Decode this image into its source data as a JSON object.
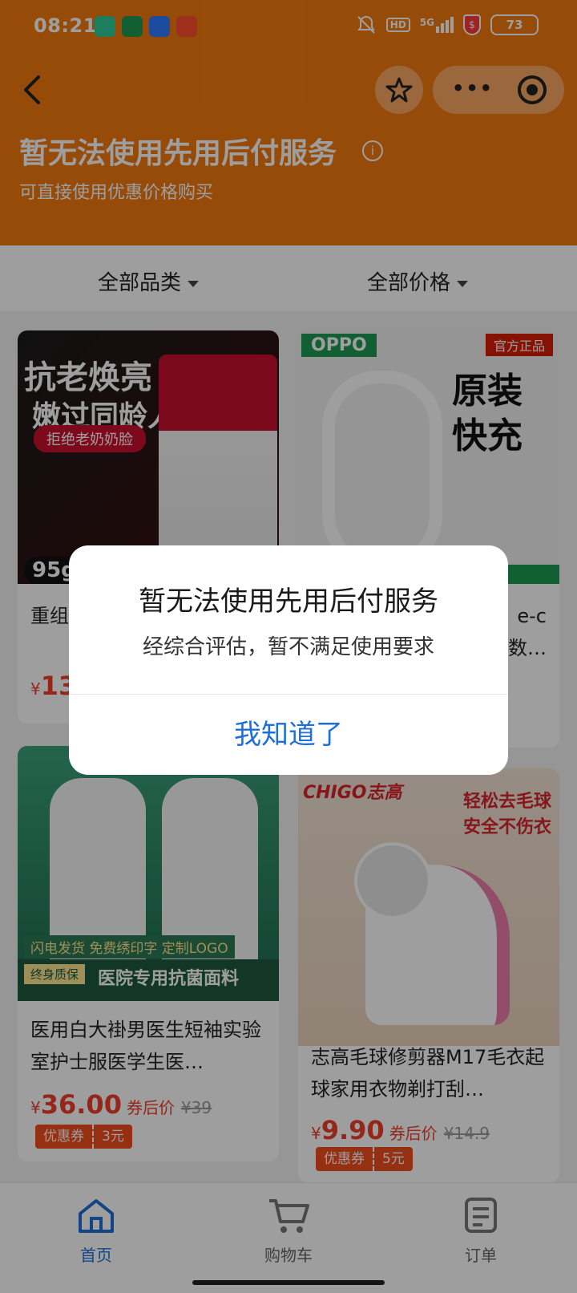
{
  "status_bar": {
    "time": "08:21",
    "network": "5G",
    "hd": "HD",
    "battery": "73"
  },
  "header": {
    "title": "暂无法使用先用后付服务",
    "subtitle": "可直接使用优惠价格购买",
    "info_icon": "i"
  },
  "filters": {
    "category": "全部品类",
    "price": "全部价格"
  },
  "products": [
    {
      "name": "重组抗皱",
      "price_prefix": "¥",
      "price": "13",
      "image_text": {
        "line1": "抗老焕亮",
        "line2": "嫩过同龄人",
        "pill": "拒绝老奶奶脸",
        "badge": "95g"
      }
    },
    {
      "name_line1": "e-c",
      "name_line2": "数…",
      "image_text": {
        "brand": "OPPO",
        "official": "官方正品",
        "big": "原装\n快充"
      }
    },
    {
      "name": "医用白大褂男医生短袖实验室护士服医学生医…",
      "price_prefix": "¥",
      "price": "36.00",
      "after": "券后价",
      "orig": "¥39",
      "coupon_label": "优惠券",
      "coupon_value": "3元",
      "image_text": {
        "ship": "闪电发货 免费绣印字 定制LOGO",
        "warranty": "终身质保",
        "slogan": "医院专用抗菌面料"
      }
    },
    {
      "name": "志高毛球修剪器M17毛衣起球家用衣物剃打刮…",
      "price_prefix": "¥",
      "price": "9.90",
      "after": "券后价",
      "orig": "¥14.9",
      "coupon_label": "优惠券",
      "coupon_value": "5元",
      "image_text": {
        "brand": "CHIGO志高",
        "slogan_line1": "轻松去毛球",
        "slogan_line2": "安全不伤衣"
      }
    }
  ],
  "bottom_nav": [
    {
      "label": "首页",
      "icon": "home-icon",
      "active": true
    },
    {
      "label": "购物车",
      "icon": "cart-icon",
      "active": false
    },
    {
      "label": "订单",
      "icon": "order-icon",
      "active": false
    }
  ],
  "dialog": {
    "title": "暂无法使用先用后付服务",
    "message": "经综合评估，暂不满足使用要求",
    "button": "我知道了"
  },
  "colors": {
    "brand": "#f47a0f",
    "price": "#ef3e2a",
    "link": "#1e6fd9",
    "active_nav": "#1e6fd9"
  }
}
